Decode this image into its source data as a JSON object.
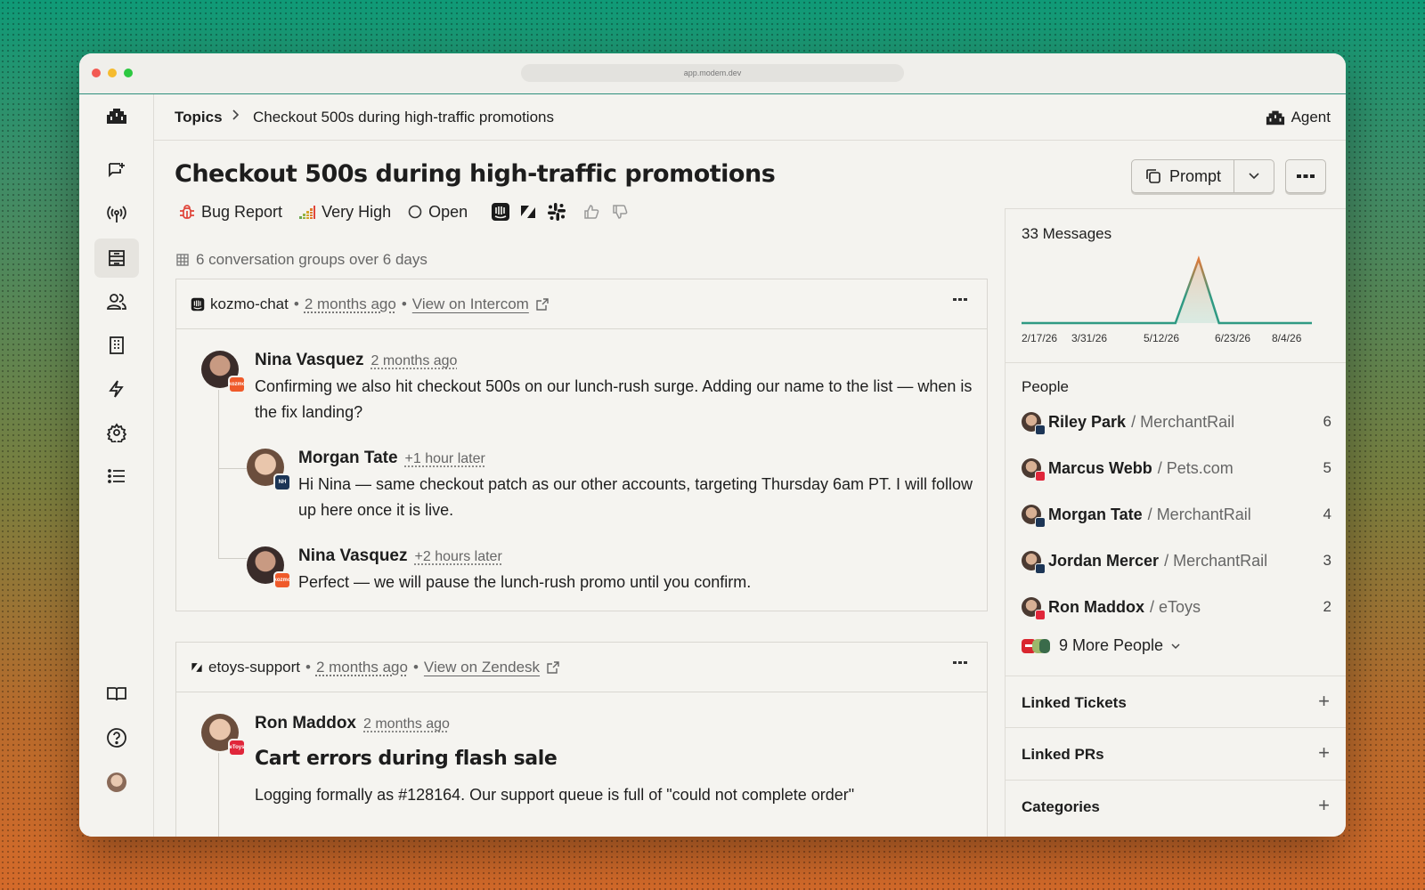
{
  "browser": {
    "url": "app.modem.dev"
  },
  "breadcrumb": {
    "root": "Topics",
    "current": "Checkout 500s during high-traffic promotions"
  },
  "header": {
    "agent_label": "Agent"
  },
  "topic": {
    "title": "Checkout 500s during high-traffic promotions",
    "type": "Bug Report",
    "priority": "Very High",
    "status": "Open",
    "groups_summary": "6 conversation groups over 6 days"
  },
  "actions": {
    "prompt_label": "Prompt"
  },
  "conversations": [
    {
      "channel": "kozmo-chat",
      "age": "2 months ago",
      "link_text": "View on Intercom",
      "messages": [
        {
          "author": "Nina Vasquez",
          "when": "2 months ago",
          "text": "Confirming we also hit checkout 500s on our lunch-rush surge. Adding our name to the list — when is the fix landing?"
        },
        {
          "author": "Morgan Tate",
          "when": "+1 hour later",
          "text": "Hi Nina — same checkout patch as our other accounts, targeting Thursday 6am PT. I will follow up here once it is live."
        },
        {
          "author": "Nina Vasquez",
          "when": "+2 hours later",
          "text": "Perfect — we will pause the lunch-rush promo until you confirm."
        }
      ]
    },
    {
      "channel": "etoys-support",
      "age": "2 months ago",
      "link_text": "View on Zendesk",
      "messages": [
        {
          "author": "Ron Maddox",
          "when": "2 months ago",
          "subject": "Cart errors during flash sale",
          "text": "Logging formally as #128164. Our support queue is full of \"could not complete order\""
        }
      ]
    }
  ],
  "right_panel": {
    "messages_label": "33 Messages",
    "people_heading": "People",
    "people": [
      {
        "name": "Riley Park",
        "org": "MerchantRail",
        "count": "6"
      },
      {
        "name": "Marcus Webb",
        "org": "Pets.com",
        "count": "5"
      },
      {
        "name": "Morgan Tate",
        "org": "MerchantRail",
        "count": "4"
      },
      {
        "name": "Jordan Mercer",
        "org": "MerchantRail",
        "count": "3"
      },
      {
        "name": "Ron Maddox",
        "org": "eToys",
        "count": "2"
      }
    ],
    "more_people": "9 More People",
    "linked_tickets": "Linked Tickets",
    "linked_prs": "Linked PRs",
    "categories": "Categories"
  },
  "chart_data": {
    "type": "area",
    "x": [
      "2/17/26",
      "3/31/26",
      "5/12/26",
      "6/23/26",
      "8/4/26"
    ],
    "values": [
      0,
      0,
      0,
      33,
      0
    ],
    "x_tick_labels": [
      "2/17/26",
      "3/31/26",
      "5/12/26",
      "6/23/26",
      "8/4/26"
    ],
    "title": "33 Messages",
    "colors": {
      "line": "#2f9a83",
      "peak": "#e07a3a"
    }
  },
  "colors": {
    "accent_teal": "#2f8f7c",
    "bug_red": "#e0453a",
    "intercom_badge": "#ef5a2a",
    "merchantrail_badge": "#1c3556",
    "etoys_badge": "#e0263a"
  }
}
